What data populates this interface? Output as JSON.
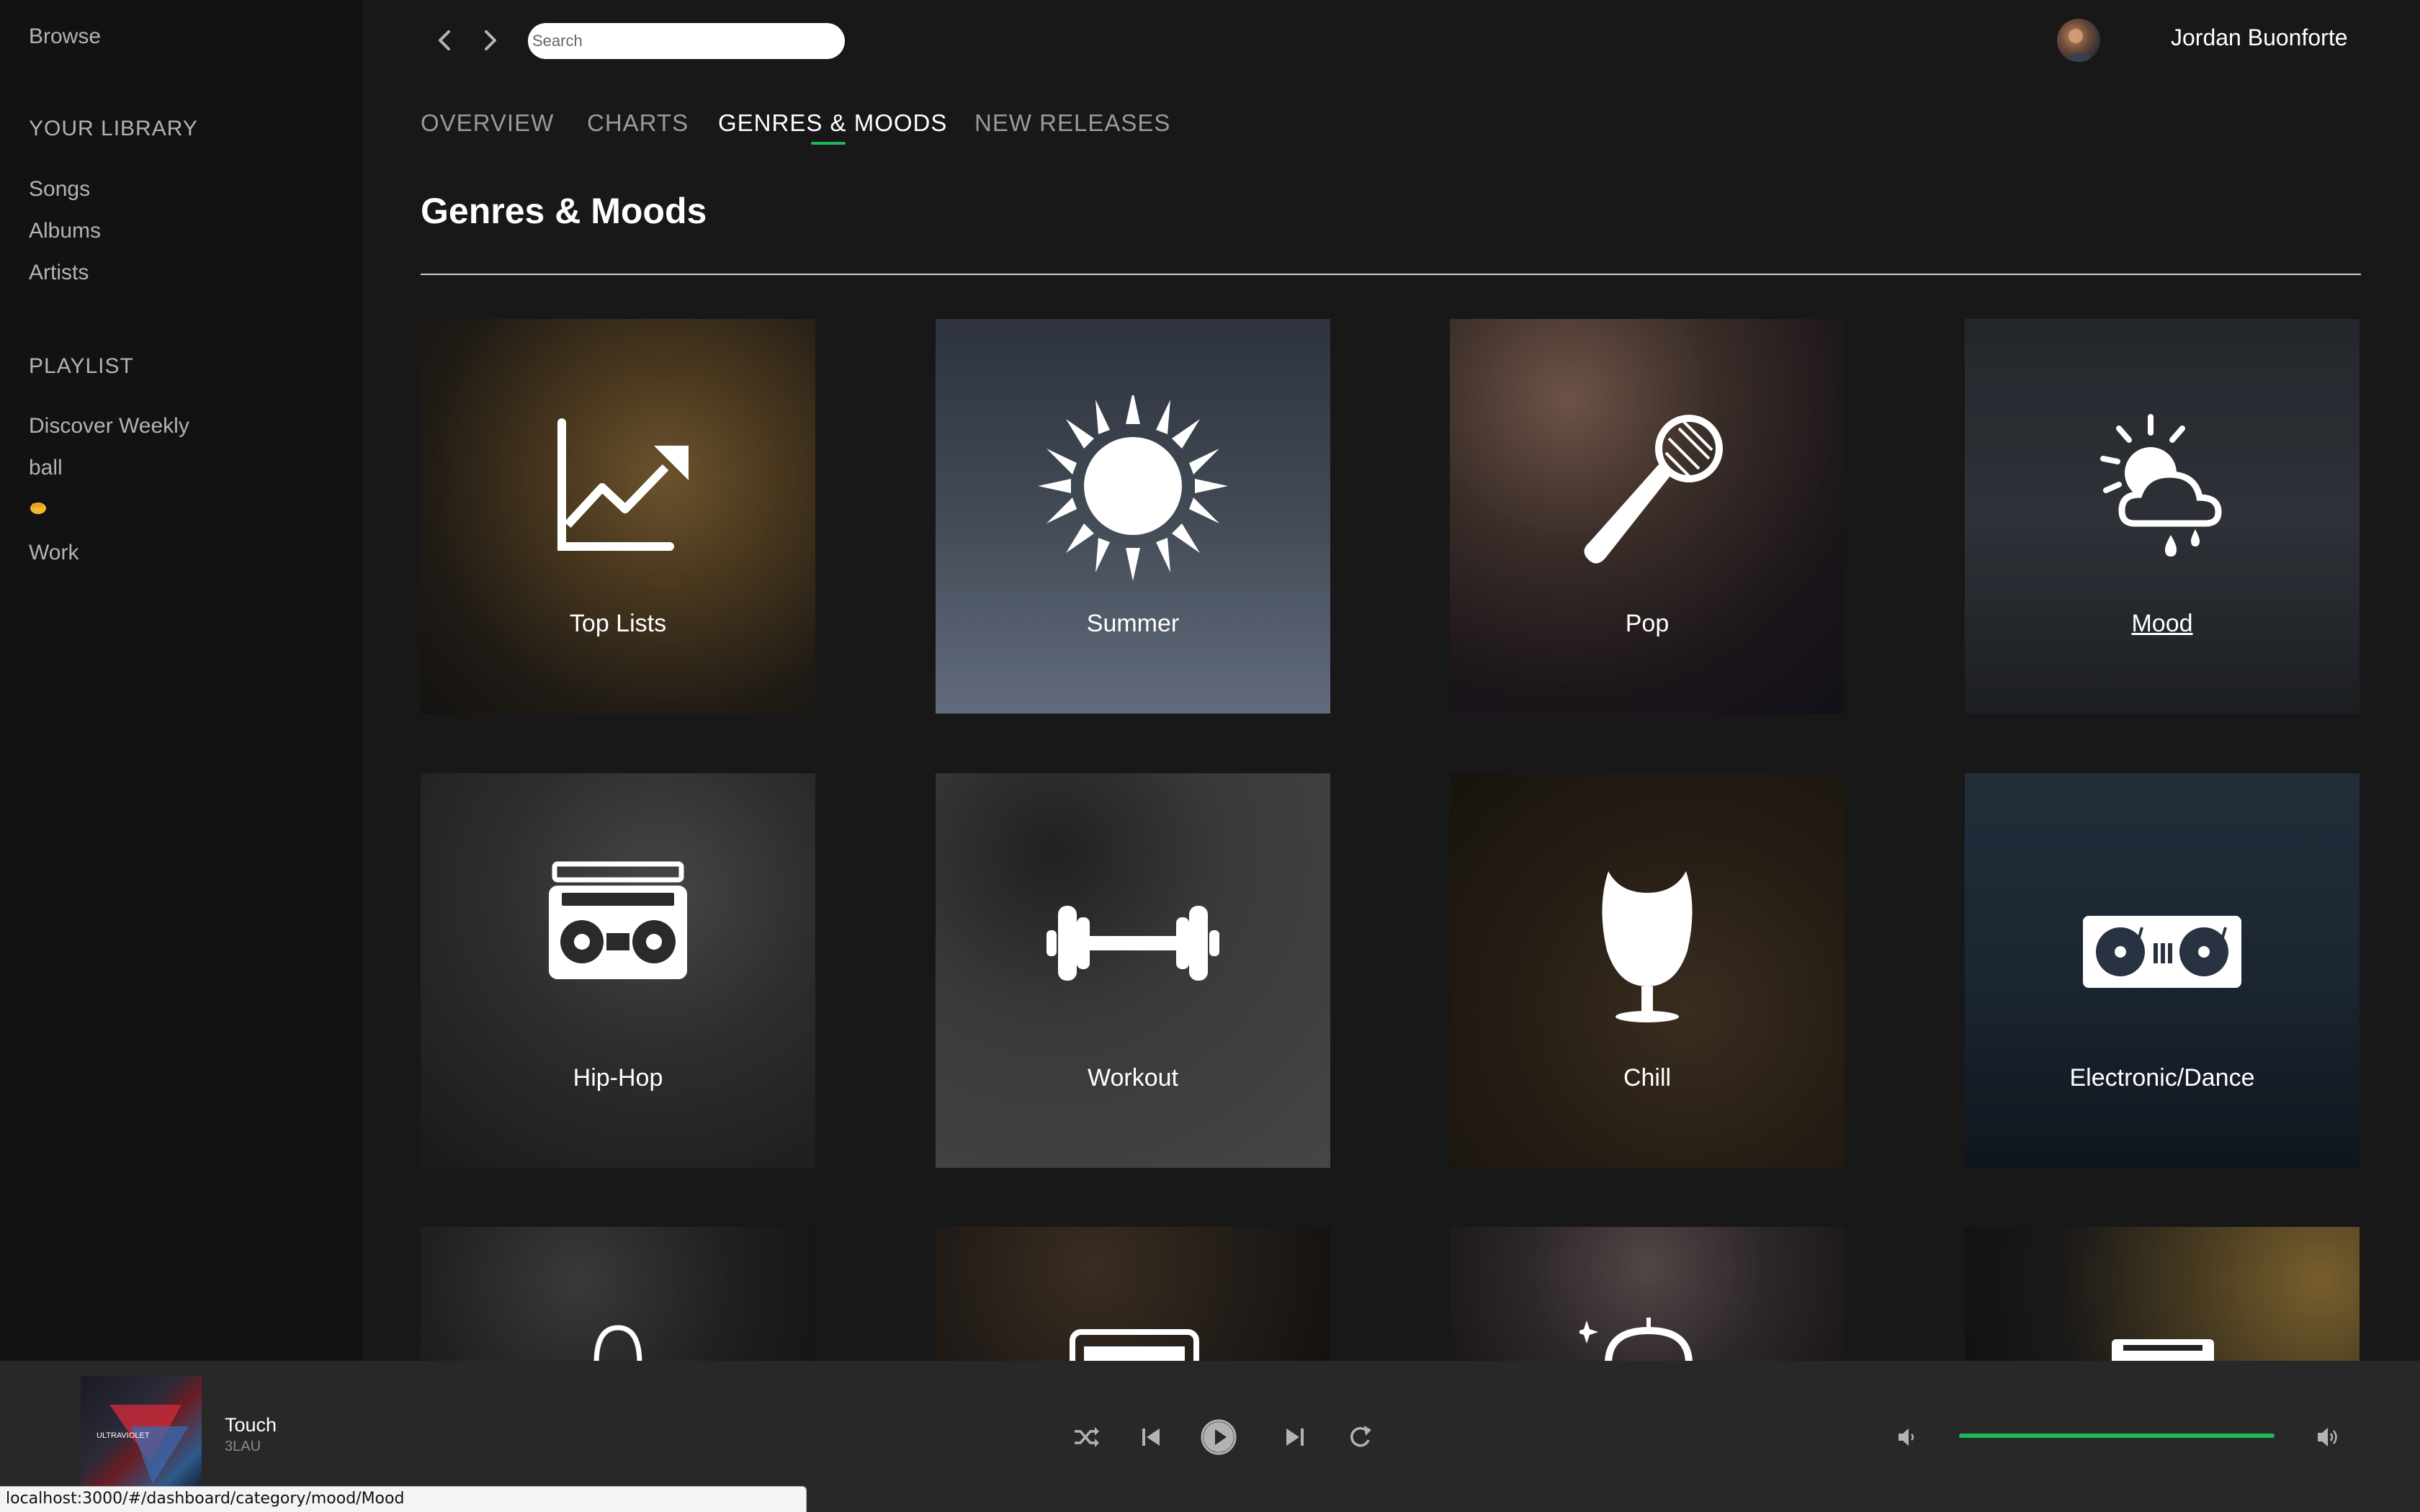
{
  "sidebar": {
    "browse": "Browse",
    "library_heading": "YOUR LIBRARY",
    "library_items": [
      "Songs",
      "Albums",
      "Artists"
    ],
    "playlist_heading": "PLAYLIST",
    "playlists": [
      "Discover Weekly",
      "ball",
      "Work"
    ],
    "emoji_playlist_icon": "fist-bump-emoji"
  },
  "header": {
    "search_placeholder": "Search",
    "username": "Jordan Buonforte"
  },
  "tabs": [
    {
      "label": "OVERVIEW",
      "active": false
    },
    {
      "label": "CHARTS",
      "active": false
    },
    {
      "label": "GENRES & MOODS",
      "active": true
    },
    {
      "label": "NEW RELEASES",
      "active": false
    }
  ],
  "page_title": "Genres & Moods",
  "categories": [
    {
      "label": "Top Lists",
      "icon": "chart-up-icon"
    },
    {
      "label": "Summer",
      "icon": "sun-icon"
    },
    {
      "label": "Pop",
      "icon": "microphone-icon"
    },
    {
      "label": "Mood",
      "icon": "weather-mood-icon"
    },
    {
      "label": "Hip-Hop",
      "icon": "boombox-icon"
    },
    {
      "label": "Workout",
      "icon": "dumbbell-icon"
    },
    {
      "label": "Chill",
      "icon": "egg-chair-icon"
    },
    {
      "label": "Electronic/Dance",
      "icon": "turntable-icon"
    },
    {
      "label": "",
      "icon": "headphones-icon"
    },
    {
      "label": "",
      "icon": "amplifier-icon"
    },
    {
      "label": "",
      "icon": "disco-ball-icon"
    },
    {
      "label": "",
      "icon": "cassette-icon"
    }
  ],
  "player": {
    "track_title": "Touch",
    "track_artist": "3LAU",
    "album_text": "ULTRAVIOLET",
    "volume": 1.0
  },
  "statusbar": {
    "url": "localhost:3000/#/dashboard/category/mood/Mood"
  },
  "colors": {
    "accent": "#1db954",
    "background": "#181818",
    "sidebar": "#121212",
    "player": "#282828"
  }
}
